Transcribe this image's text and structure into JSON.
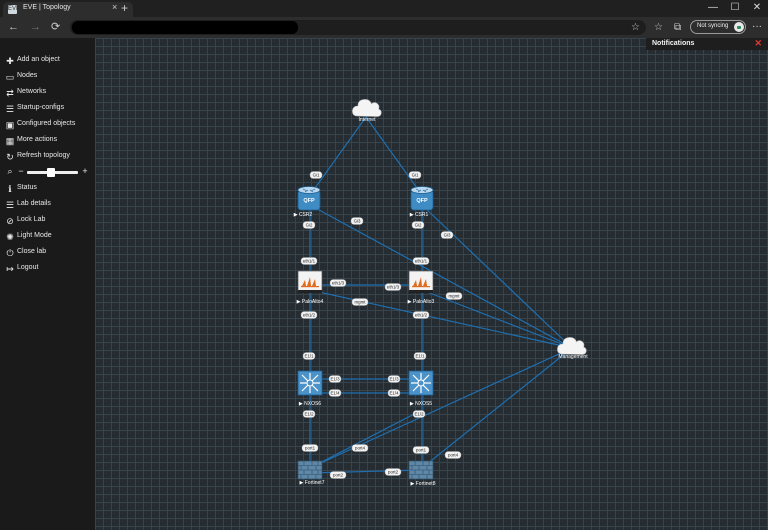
{
  "browser": {
    "tab_title": "EVE | Topology",
    "favicon": "EVE",
    "tab_close": "×",
    "new_tab": "+",
    "window_controls": [
      "—",
      "☐",
      "✕"
    ],
    "nav": {
      "back": "←",
      "forward": "→",
      "refresh": "⟳"
    },
    "toolbar_icons": [
      "☆",
      "☆",
      "⧉"
    ],
    "sync_label": "Not syncing",
    "more": "···"
  },
  "sidebar": {
    "items": [
      {
        "icon": "✚",
        "label": "Add an object"
      },
      {
        "icon": "▭",
        "label": "Nodes"
      },
      {
        "icon": "⇄",
        "label": "Networks"
      },
      {
        "icon": "☰",
        "label": "Startup-configs"
      },
      {
        "icon": "▣",
        "label": "Configured objects"
      },
      {
        "icon": "▦",
        "label": "More actions"
      },
      {
        "icon": "↻",
        "label": "Refresh topology"
      }
    ],
    "zoom": {
      "icon": "⌕",
      "minus": "−",
      "plus": "+",
      "level": 0.55
    },
    "items2": [
      {
        "icon": "ℹ",
        "label": "Status"
      },
      {
        "icon": "☰",
        "label": "Lab details"
      },
      {
        "icon": "⊘",
        "label": "Lock Lab"
      },
      {
        "icon": "✺",
        "label": "Light Mode"
      },
      {
        "icon": "⏻",
        "label": "Close lab"
      },
      {
        "icon": "↦",
        "label": "Logout"
      }
    ]
  },
  "notifications": {
    "title": "Notifications",
    "close": "✕"
  },
  "colors": {
    "link": "#1f6fb0",
    "grid": "#38444c",
    "canvas": "#252d33",
    "device_blue": "#3f8bc4"
  },
  "topology": {
    "nodes": [
      {
        "id": "internet",
        "name": "Internet",
        "type": "cloud"
      },
      {
        "id": "management",
        "name": "Management",
        "type": "cloud"
      },
      {
        "id": "csr2",
        "name": "CSR2",
        "type": "router"
      },
      {
        "id": "csr1",
        "name": "CSR1",
        "type": "router"
      },
      {
        "id": "pa4",
        "name": "PaloAlto4",
        "type": "firewall"
      },
      {
        "id": "pa3",
        "name": "PaloAlto3",
        "type": "firewall"
      },
      {
        "id": "nx56",
        "name": "NXOS6",
        "type": "switch"
      },
      {
        "id": "nx55",
        "name": "NXOS5",
        "type": "switch"
      },
      {
        "id": "fg7",
        "name": "Fortinet7",
        "type": "fortigate"
      },
      {
        "id": "fg8",
        "name": "Fortinet8",
        "type": "fortigate"
      }
    ],
    "interface_labels": [
      "Gi1",
      "Gi1",
      "Gi2",
      "Gi3",
      "Gi2",
      "Gi3",
      "eth1/1",
      "eth1/1",
      "eth1/3",
      "eth1/3",
      "mgmt",
      "mgmt",
      "eth1/2",
      "eth1/2",
      "E1/1",
      "E1/1",
      "E1/3",
      "E1/3",
      "E1/4",
      "E1/4",
      "E1/2",
      "E1/2",
      "port1",
      "port1",
      "port4",
      "port4",
      "port2",
      "port2"
    ]
  }
}
